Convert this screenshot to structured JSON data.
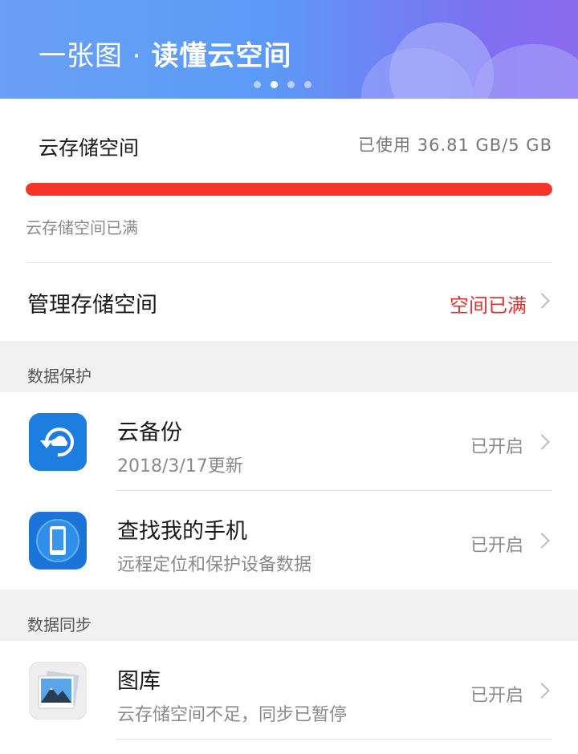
{
  "banner": {
    "title_prefix": "一张图 · ",
    "title_main": "读懂云空间",
    "page_indicator": {
      "total": 4,
      "active": 2
    }
  },
  "storage": {
    "label": "云存储空间",
    "usage_text": "已使用 36.81 GB/5 GB",
    "usage_fraction": 1.0,
    "bar_color": "#f5342a",
    "note": "云存储空间已满",
    "manage_label": "管理存储空间",
    "manage_status": "空间已满",
    "status_color": "#e0312d"
  },
  "data_protection": {
    "header": "数据保护",
    "items": [
      {
        "title": "云备份",
        "subtitle": "2018/3/17更新",
        "status": "已开启",
        "icon": "cloud-backup-icon"
      },
      {
        "title": "查找我的手机",
        "subtitle": "远程定位和保护设备数据",
        "status": "已开启",
        "icon": "find-phone-icon"
      }
    ]
  },
  "data_sync": {
    "header": "数据同步",
    "items": [
      {
        "title": "图库",
        "subtitle": "云存储空间不足，同步已暂停",
        "status": "已开启",
        "icon": "gallery-icon"
      }
    ]
  }
}
